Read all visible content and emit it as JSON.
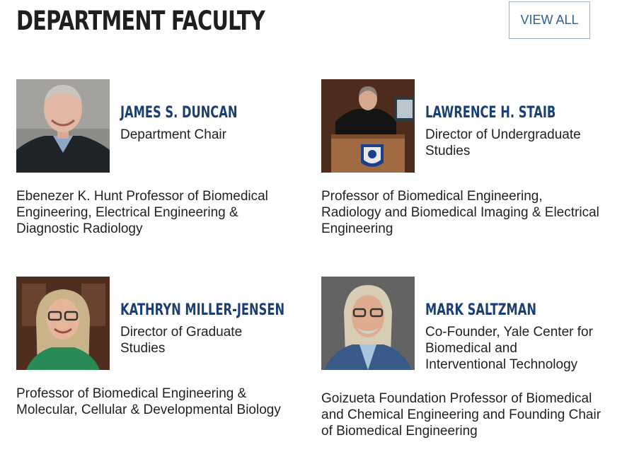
{
  "section": {
    "title": "DEPARTMENT FACULTY",
    "view_all_label": "VIEW ALL"
  },
  "faculty": [
    {
      "name": "JAMES S. DUNCAN",
      "role": "Department Chair",
      "description": "Ebenezer K. Hunt Professor of Biomedical Engineering, Electrical Engineering & Diagnostic Radiology"
    },
    {
      "name": "LAWRENCE H. STAIB",
      "role": "Director of Undergraduate Studies",
      "description": "Professor of Biomedical Engineering, Radiology and Biomedical Imaging & Electrical Engineering"
    },
    {
      "name": "KATHRYN MILLER-JENSEN",
      "role": "Director of Graduate Studies",
      "description": "Professor of Biomedical Engineering & Molecular, Cellular & Developmental Biology"
    },
    {
      "name": "MARK SALTZMAN",
      "role": "Co-Founder, Yale Center for Biomedical and Interventional Technology",
      "description": "Goizueta Foundation Professor of Biomedical and Chemical Engineering and Founding Chair of Biomedical Engineering"
    }
  ],
  "colors": {
    "title": "#1f1f1f",
    "name": "#1c3f73",
    "button_text": "#2c5f9e",
    "button_border": "#9db0c8",
    "body_text": "#222222"
  }
}
